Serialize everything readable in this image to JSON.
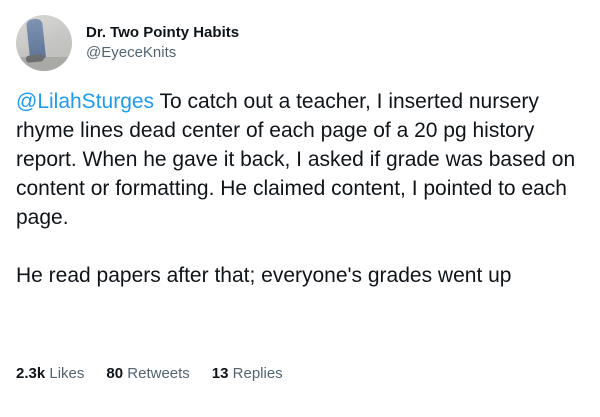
{
  "author": {
    "display_name": "Dr. Two Pointy Habits",
    "handle": "@EyeceKnits",
    "avatar_icon": "avatar-photo"
  },
  "tweet": {
    "mention": "@LilahSturges",
    "paragraph1_rest": " To catch out a teacher, I inserted nursery rhyme lines dead center of each page of a 20 pg history report. When he gave it back, I asked if grade was based on content or formatting. He claimed content, I pointed to each page.",
    "paragraph2": "He read papers after that; everyone's grades went up"
  },
  "stats": {
    "likes_count": "2.3k",
    "likes_label": "Likes",
    "retweets_count": "80",
    "retweets_label": "Retweets",
    "replies_count": "13",
    "replies_label": "Replies"
  },
  "colors": {
    "text": "#0f1419",
    "secondary": "#536471",
    "link": "#1d9bf0",
    "background": "#ffffff"
  }
}
